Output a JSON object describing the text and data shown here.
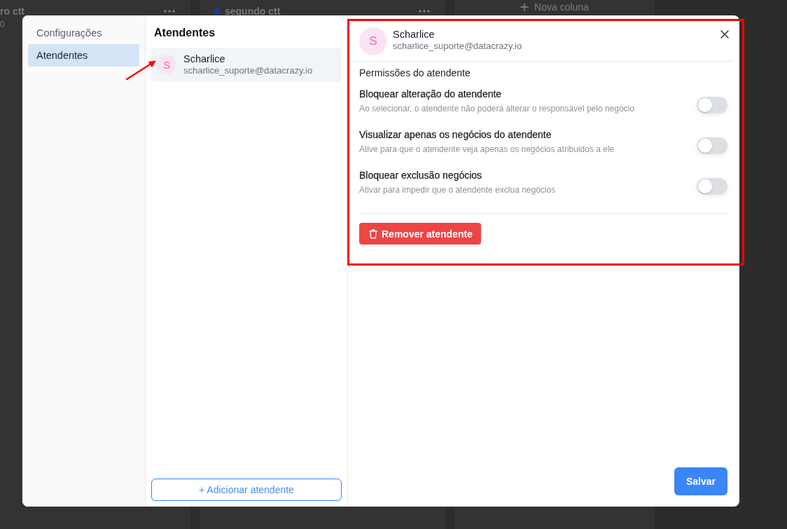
{
  "background": {
    "columns": [
      {
        "kind": "column",
        "title": "ro ctt",
        "count": "0"
      },
      {
        "kind": "column",
        "title": "segundo ctt",
        "color": "#1e3a8a"
      },
      {
        "kind": "add",
        "label": "Nova coluna"
      }
    ]
  },
  "dialog": {
    "sidebar": {
      "items": [
        {
          "label": "Configurações",
          "selected": false
        },
        {
          "label": "Atendentes",
          "selected": true
        }
      ]
    },
    "list": {
      "title": "Atendentes",
      "items": [
        {
          "initial": "S",
          "name": "Scharlice",
          "email": "scharlice_suporte@datacrazy.io",
          "selected": true
        }
      ],
      "add_button": "+ Adicionar atendente"
    },
    "detail": {
      "initial": "S",
      "name": "Scharlice",
      "email": "scharlice_suporte@datacrazy.io",
      "section_title": "Permissões do atendente",
      "permissions": [
        {
          "title": "Bloquear alteração do atendente",
          "description": "Ao selecionar, o atendente não poderá alterar o responsável pelo negócio",
          "on": false
        },
        {
          "title": "Visualizar apenas os negócios do atendente",
          "description": "Ative para que o atendente veja apenas os negócios atribuidos a ele",
          "on": false
        },
        {
          "title": "Bloquear exclusão negócios",
          "description": "Ativar para impedir que o atendente exclua negócios",
          "on": false
        }
      ],
      "remove_button": "Remover atendente",
      "save_button": "Salvar"
    }
  },
  "annotations": [
    {
      "kind": "rectangle"
    },
    {
      "kind": "arrow"
    }
  ]
}
